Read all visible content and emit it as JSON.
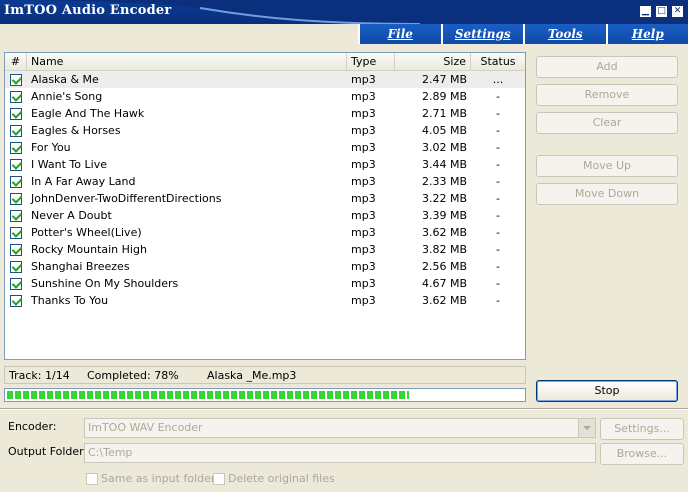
{
  "window": {
    "title": "ImTOO Audio Encoder",
    "minimize": "▁",
    "maximize": "□",
    "close": "✕"
  },
  "menu": [
    {
      "label": "File"
    },
    {
      "label": "Settings"
    },
    {
      "label": "Tools"
    },
    {
      "label": "Help"
    }
  ],
  "list": {
    "columns": {
      "index": "#",
      "name": "Name",
      "type": "Type",
      "size": "Size",
      "status": "Status"
    },
    "rows": [
      {
        "name": "Alaska & Me",
        "type": "mp3",
        "size": "2.47 MB",
        "status": "..."
      },
      {
        "name": "Annie's Song",
        "type": "mp3",
        "size": "2.89 MB",
        "status": "-"
      },
      {
        "name": "Eagle And The Hawk",
        "type": "mp3",
        "size": "2.71 MB",
        "status": "-"
      },
      {
        "name": "Eagles & Horses",
        "type": "mp3",
        "size": "4.05 MB",
        "status": "-"
      },
      {
        "name": "For You",
        "type": "mp3",
        "size": "3.02 MB",
        "status": "-"
      },
      {
        "name": "I Want To Live",
        "type": "mp3",
        "size": "3.44 MB",
        "status": "-"
      },
      {
        "name": "In A Far Away Land",
        "type": "mp3",
        "size": "2.33 MB",
        "status": "-"
      },
      {
        "name": "JohnDenver-TwoDifferentDirections",
        "type": "mp3",
        "size": "3.22 MB",
        "status": "-"
      },
      {
        "name": "Never A Doubt",
        "type": "mp3",
        "size": "3.39 MB",
        "status": "-"
      },
      {
        "name": "Potter's Wheel(Live)",
        "type": "mp3",
        "size": "3.62 MB",
        "status": "-"
      },
      {
        "name": "Rocky Mountain High",
        "type": "mp3",
        "size": "3.82 MB",
        "status": "-"
      },
      {
        "name": "Shanghai Breezes",
        "type": "mp3",
        "size": "2.56 MB",
        "status": "-"
      },
      {
        "name": "Sunshine On My Shoulders",
        "type": "mp3",
        "size": "4.67 MB",
        "status": "-"
      },
      {
        "name": "Thanks To You",
        "type": "mp3",
        "size": "3.62 MB",
        "status": "-"
      }
    ]
  },
  "buttons": {
    "add": "Add",
    "remove": "Remove",
    "clear": "Clear",
    "move_up": "Move Up",
    "move_down": "Move Down",
    "stop": "Stop"
  },
  "status": {
    "track": "Track: 1/14",
    "completed": "Completed: 78%",
    "file": "Alaska _Me.mp3"
  },
  "progress": {
    "value": 0.78
  },
  "form": {
    "encoder_label": "Encoder:",
    "encoder_value": "ImTOO WAV Encoder",
    "settings_button": "Settings...",
    "output_label": "Output Folder:",
    "output_value": "C:\\Temp",
    "browse_button": "Browse...",
    "same_as_input": "Same as input folder",
    "delete_original": "Delete original files"
  },
  "colors": {
    "title_bar": "#0a2f7c",
    "menu": "#1a5fc4",
    "progress": "#35d535",
    "check": "#21a121"
  }
}
